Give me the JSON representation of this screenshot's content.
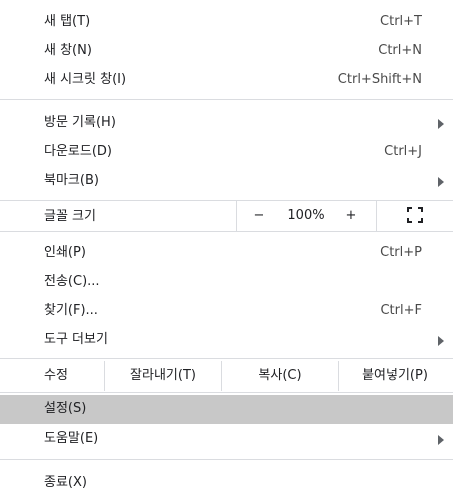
{
  "menu": {
    "new_tab": {
      "label": "새 탭(T)",
      "shortcut": "Ctrl+T"
    },
    "new_window": {
      "label": "새 창(N)",
      "shortcut": "Ctrl+N"
    },
    "new_incognito": {
      "label": "새 시크릿 창(I)",
      "shortcut": "Ctrl+Shift+N"
    },
    "history": {
      "label": "방문 기록(H)"
    },
    "downloads": {
      "label": "다운로드(D)",
      "shortcut": "Ctrl+J"
    },
    "bookmarks": {
      "label": "북마크(B)"
    },
    "zoom": {
      "label": "글꼴 크기",
      "minus": "−",
      "value": "100%",
      "plus": "+"
    },
    "print": {
      "label": "인쇄(P)",
      "shortcut": "Ctrl+P"
    },
    "cast": {
      "label": "전송(C)..."
    },
    "find": {
      "label": "찾기(F)...",
      "shortcut": "Ctrl+F"
    },
    "more_tools": {
      "label": "도구 더보기"
    },
    "edit": {
      "label": "수정",
      "cut": "잘라내기(T)",
      "copy": "복사(C)",
      "paste": "붙여넣기(P)"
    },
    "settings": {
      "label": "설정(S)"
    },
    "help": {
      "label": "도움말(E)"
    },
    "exit": {
      "label": "종료(X)"
    }
  },
  "icons": {
    "submenu": "chevron-right-icon",
    "fullscreen": "fullscreen-icon"
  },
  "colors": {
    "selected_bg": "#c8c8c8",
    "separator": "#dadce0",
    "text": "#202124"
  }
}
